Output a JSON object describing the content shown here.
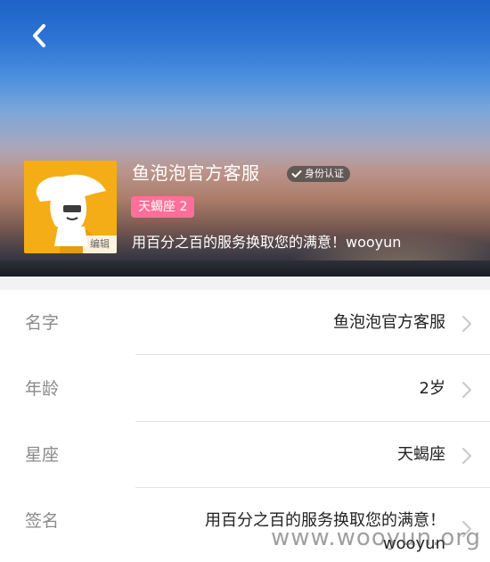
{
  "header": {
    "back_icon": "chevron-left-icon",
    "profile_name": "鱼泡泡官方客服",
    "verify_badge": "身份认证",
    "zodiac_tag": "天蝎座 2",
    "signature": "用百分之百的服务换取您的满意！wooyun",
    "avatar_edit_label": "编辑"
  },
  "rows": [
    {
      "label": "名字",
      "value": "鱼泡泡官方客服"
    },
    {
      "label": "年龄",
      "value": "2岁"
    },
    {
      "label": "星座",
      "value": "天蝎座"
    },
    {
      "label": "签名",
      "value": "用百分之百的服务换取您的满意！wooyun"
    }
  ],
  "watermark": "www.wooyun.org",
  "colors": {
    "avatar_bg": "#f5ad17",
    "zodiac_tag_bg": "#ff6f97",
    "label_gray": "#8a8a8a"
  }
}
